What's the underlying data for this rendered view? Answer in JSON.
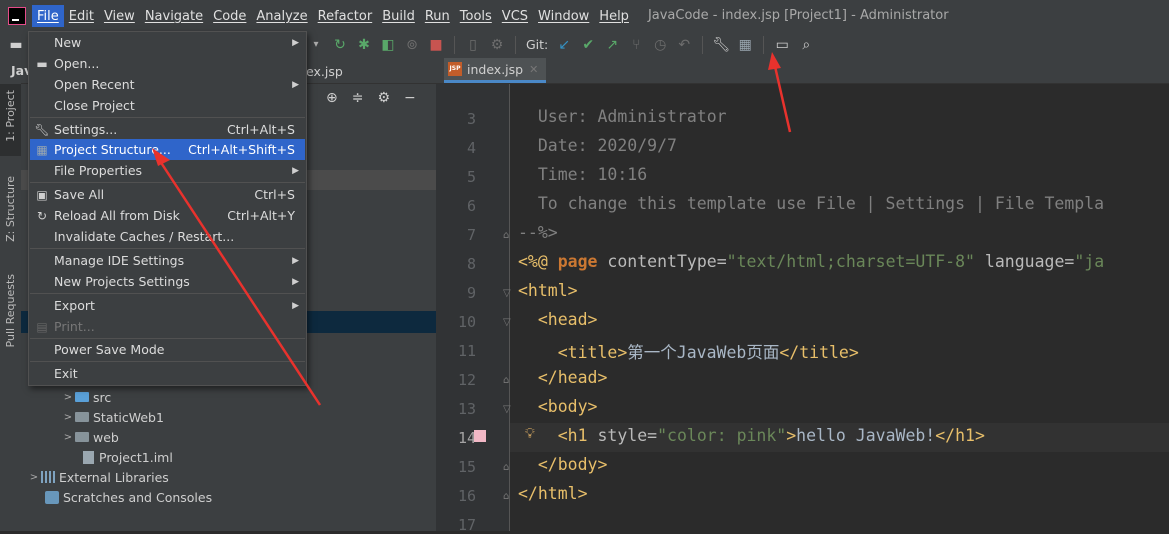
{
  "menubar": {
    "items": [
      "File",
      "Edit",
      "View",
      "Navigate",
      "Code",
      "Analyze",
      "Refactor",
      "Build",
      "Run",
      "Tools",
      "VCS",
      "Window",
      "Help"
    ],
    "window_title": "JavaCode - index.jsp [Project1] - Administrator"
  },
  "toolbar": {
    "git_label": "Git:"
  },
  "toolstrip": {
    "project_tab": "1: Project",
    "structure_tab": "Z: Structure",
    "pull_requests_tab": "Pull Requests"
  },
  "project_panel": {
    "header_label": "Jav",
    "breadcrumb": "ex.jsp",
    "tree": [
      {
        "label": "src",
        "kind": "folder-blue",
        "indent": 1
      },
      {
        "label": "StaticWeb1",
        "kind": "folder",
        "indent": 1
      },
      {
        "label": "web",
        "kind": "folder",
        "indent": 1
      },
      {
        "label": "Project1.iml",
        "kind": "file",
        "indent": 2
      },
      {
        "label": "External Libraries",
        "kind": "lib",
        "indent": 0
      },
      {
        "label": "Scratches and Consoles",
        "kind": "scratch",
        "indent": 0
      }
    ]
  },
  "editor": {
    "tab_label": "index.jsp",
    "tab_icon_text": "JSP",
    "line_numbers": [
      "3",
      "4",
      "5",
      "6",
      "7",
      "8",
      "9",
      "10",
      "11",
      "12",
      "13",
      "14",
      "15",
      "16",
      "17"
    ],
    "lines": {
      "l3": "  User: Administrator",
      "l4": "  Date: 2020/9/7",
      "l5": "  Time: 10:16",
      "l6": "  To change this template use File | Settings | File Templa",
      "l7": "--%>",
      "l8_a": "<%@ ",
      "l8_b": "page ",
      "l8_c": "contentType=",
      "l8_d": "\"text/html;charset=UTF-8\"",
      "l8_e": " language=",
      "l8_f": "\"ja",
      "l9": "<html>",
      "l10": "  <head>",
      "l11_a": "    <title>",
      "l11_b": "第一个JavaWeb页面",
      "l11_c": "</title>",
      "l12": "  </head>",
      "l13": "  <body>",
      "l14_a": "    <h1 ",
      "l14_b": "style=",
      "l14_c": "\"color: pink\"",
      "l14_d": ">",
      "l14_e": "hello JavaWeb!",
      "l14_f": "</h1>",
      "l15": "  </body>",
      "l16": "</html>"
    }
  },
  "file_menu": {
    "items": [
      {
        "label": "New",
        "shortcut": "",
        "submenu": true,
        "icon": ""
      },
      {
        "label": "Open...",
        "shortcut": "",
        "submenu": false,
        "icon": "folder-open-icon"
      },
      {
        "label": "Open Recent",
        "shortcut": "",
        "submenu": true,
        "icon": ""
      },
      {
        "label": "Close Project",
        "shortcut": "",
        "submenu": false,
        "icon": ""
      },
      {
        "label": "Settings...",
        "shortcut": "Ctrl+Alt+S",
        "submenu": false,
        "icon": "wrench-icon"
      },
      {
        "label": "Project Structure...",
        "shortcut": "Ctrl+Alt+Shift+S",
        "submenu": false,
        "icon": "project-structure-icon",
        "selected": true
      },
      {
        "label": "File Properties",
        "shortcut": "",
        "submenu": true,
        "icon": ""
      },
      {
        "label": "Save All",
        "shortcut": "Ctrl+S",
        "submenu": false,
        "icon": "save-icon"
      },
      {
        "label": "Reload All from Disk",
        "shortcut": "Ctrl+Alt+Y",
        "submenu": false,
        "icon": "reload-icon"
      },
      {
        "label": "Invalidate Caches / Restart...",
        "shortcut": "",
        "submenu": false,
        "icon": ""
      },
      {
        "label": "Manage IDE Settings",
        "shortcut": "",
        "submenu": true,
        "icon": ""
      },
      {
        "label": "New Projects Settings",
        "shortcut": "",
        "submenu": true,
        "icon": ""
      },
      {
        "label": "Export",
        "shortcut": "",
        "submenu": true,
        "icon": ""
      },
      {
        "label": "Print...",
        "shortcut": "",
        "submenu": false,
        "icon": "print-icon",
        "disabled": true
      },
      {
        "label": "Power Save Mode",
        "shortcut": "",
        "submenu": false,
        "icon": ""
      },
      {
        "label": "Exit",
        "shortcut": "",
        "submenu": false,
        "icon": ""
      }
    ]
  },
  "colors": {
    "accent": "#2f65ca",
    "annotation": "#e8322d"
  }
}
